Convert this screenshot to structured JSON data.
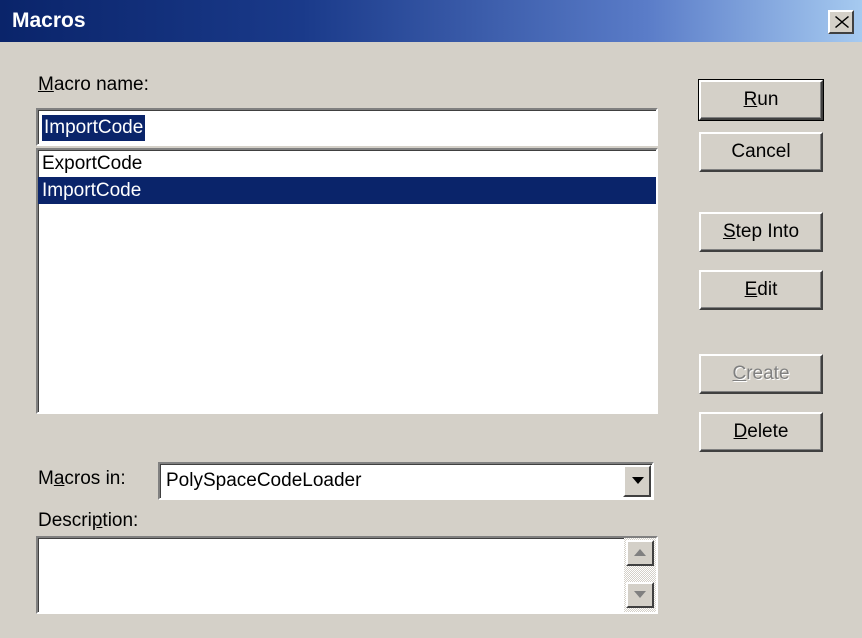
{
  "window": {
    "title": "Macros"
  },
  "labels": {
    "macro_name_pre": "",
    "macro_name_u": "M",
    "macro_name_post": "acro name:",
    "macros_in_pre": "M",
    "macros_in_u": "a",
    "macros_in_post": "cros in:",
    "description_pre": "Descri",
    "description_u": "p",
    "description_post": "tion:"
  },
  "macro_name_input": {
    "value": "ImportCode"
  },
  "macro_list": [
    {
      "label": "ExportCode",
      "selected": false
    },
    {
      "label": "ImportCode",
      "selected": true
    }
  ],
  "macros_in": {
    "value": "PolySpaceCodeLoader"
  },
  "description": {
    "value": ""
  },
  "buttons": {
    "run": {
      "pre": "",
      "u": "R",
      "post": "un"
    },
    "cancel": {
      "label": "Cancel"
    },
    "step_into": {
      "pre": "",
      "u": "S",
      "post": "tep Into"
    },
    "edit": {
      "pre": "",
      "u": "E",
      "post": "dit"
    },
    "create": {
      "pre": "",
      "u": "C",
      "post": "reate"
    },
    "delete": {
      "pre": "",
      "u": "D",
      "post": "elete"
    }
  },
  "colors": {
    "selection": "#0a246a",
    "face": "#d4d0c8",
    "title_start": "#0a246a",
    "title_end": "#a6caf0"
  },
  "icons": {
    "close": "close-icon",
    "dropdown": "chevron-down-icon",
    "scroll_up": "arrow-up-icon",
    "scroll_down": "arrow-down-icon"
  }
}
